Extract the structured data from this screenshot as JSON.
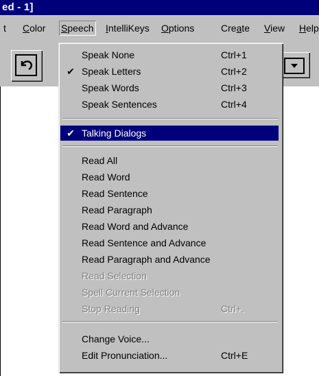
{
  "window": {
    "title": "ed - 1]"
  },
  "menubar": {
    "items": [
      {
        "label": "t",
        "id": "text"
      },
      {
        "label": "Color",
        "id": "color"
      },
      {
        "label": "Speech",
        "id": "speech"
      },
      {
        "label": "IntelliKeys",
        "id": "intellikeys"
      },
      {
        "label": "Options",
        "id": "options"
      },
      {
        "label": "Create",
        "id": "create"
      },
      {
        "label": "View",
        "id": "view"
      },
      {
        "label": "Help",
        "id": "help"
      }
    ],
    "active": "Speech"
  },
  "speech_menu": {
    "group1": [
      {
        "label": "Speak None",
        "shortcut": "Ctrl+1",
        "checked": false
      },
      {
        "label": "Speak Letters",
        "shortcut": "Ctrl+2",
        "checked": true
      },
      {
        "label": "Speak Words",
        "shortcut": "Ctrl+3",
        "checked": false
      },
      {
        "label": "Speak Sentences",
        "shortcut": "Ctrl+4",
        "checked": false
      }
    ],
    "group2": [
      {
        "label": "Talking Dialogs",
        "shortcut": "",
        "checked": true,
        "highlighted": true
      }
    ],
    "group3": [
      {
        "label": "Read All",
        "shortcut": "",
        "enabled": true
      },
      {
        "label": "Read Word",
        "shortcut": "",
        "enabled": true
      },
      {
        "label": "Read Sentence",
        "shortcut": "",
        "enabled": true
      },
      {
        "label": "Read Paragraph",
        "shortcut": "",
        "enabled": true
      },
      {
        "label": "Read Word and Advance",
        "shortcut": "",
        "enabled": true
      },
      {
        "label": "Read Sentence and Advance",
        "shortcut": "",
        "enabled": true
      },
      {
        "label": "Read Paragraph and Advance",
        "shortcut": "",
        "enabled": true
      },
      {
        "label": "Read Selection",
        "shortcut": "",
        "enabled": false
      },
      {
        "label": "Spell Current Selection",
        "shortcut": "",
        "enabled": false
      },
      {
        "label": "Stop Reading",
        "shortcut": "Ctrl+.",
        "enabled": false
      }
    ],
    "group4": [
      {
        "label": "Change Voice...",
        "shortcut": ""
      },
      {
        "label": "Edit Pronunciation...",
        "shortcut": "Ctrl+E"
      }
    ],
    "check_mark": "✔"
  },
  "toolbar": {
    "undo_icon": "undo-arrow-icon",
    "dropdown_icon": "dropdown-arrow-icon"
  }
}
